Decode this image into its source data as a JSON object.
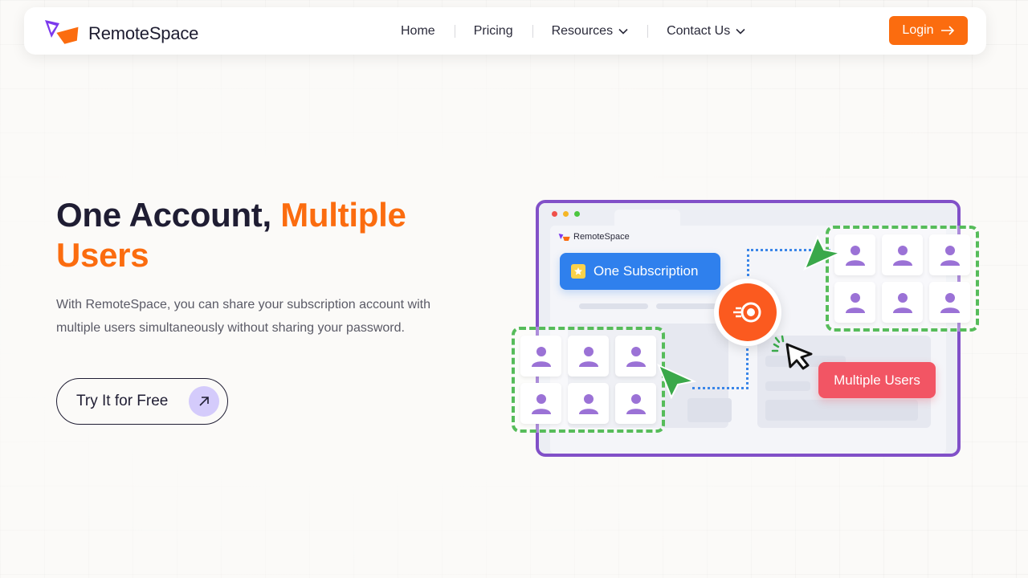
{
  "brand": {
    "name": "RemoteSpace",
    "logo_icon": "remotespace-logo-icon"
  },
  "nav": {
    "links": [
      {
        "label": "Home",
        "has_dropdown": false
      },
      {
        "label": "Pricing",
        "has_dropdown": false
      },
      {
        "label": "Resources",
        "has_dropdown": true
      },
      {
        "label": "Contact Us",
        "has_dropdown": true
      }
    ],
    "login_label": "Login"
  },
  "hero": {
    "title_main": "One Account,",
    "title_accent": "Multiple Users",
    "title_accent_part1": "Multiple",
    "title_accent_part2": "Users",
    "description": "With RemoteSpace, you can share your subscription account with multiple users simultaneously without sharing your password.",
    "cta_label": "Try It for Free"
  },
  "illustration": {
    "mini_brand": "RemoteSpace",
    "subscription_badge": "One Subscription",
    "multiple_users_badge": "Multiple Users",
    "users_left_count": 6,
    "users_right_count": 6
  },
  "colors": {
    "accent": "#fb6c0f",
    "primary_text": "#1f1d33",
    "browser_border": "#8150c8",
    "subscription_blue": "#2f80ed",
    "multi_users_red": "#f25564",
    "dashed_green": "#56bc5a",
    "user_icon_purple": "#9b72d6"
  }
}
